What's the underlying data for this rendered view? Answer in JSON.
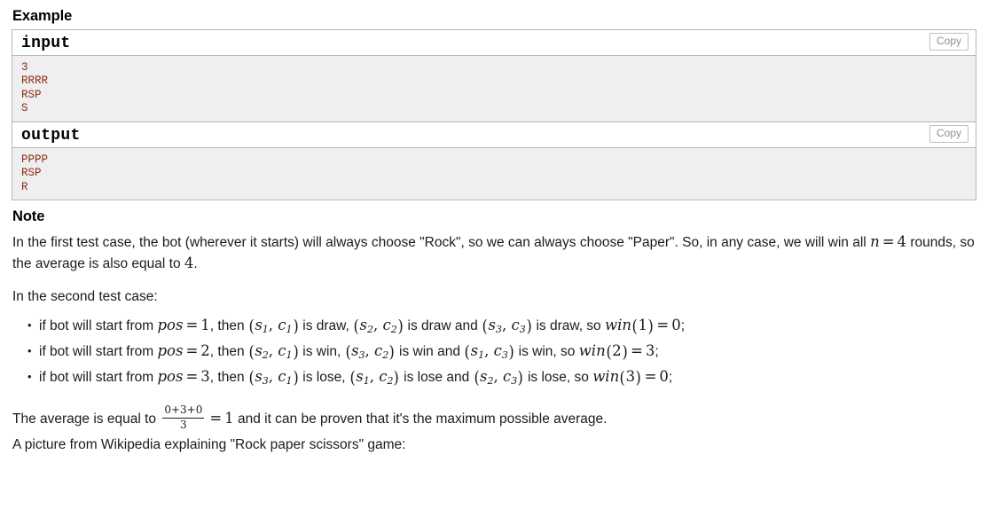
{
  "example": {
    "heading": "Example",
    "blocks": [
      {
        "title": "input",
        "copy_label": "Copy",
        "content": "3\nRRRR\nRSP\nS"
      },
      {
        "title": "output",
        "copy_label": "Copy",
        "content": "PPPP\nRSP\nR"
      }
    ]
  },
  "note": {
    "heading": "Note",
    "para1_a": "In the first test case, the bot (wherever it starts) will always choose \"Rock\", so we can always choose \"Paper\". So, in any case, we will win all ",
    "para1_math_n": "n",
    "para1_math_eq": "=",
    "para1_math_4": "4",
    "para1_b": " rounds, so the average is also equal to ",
    "para1_math_4b": "4",
    "para1_c": ".",
    "para2": "In the second test case:",
    "bullets": [
      {
        "lead": "if bot will start from ",
        "pos_var": "pos",
        "eq": "=",
        "pos_val": "1",
        "comma_then": ", then ",
        "pair1": [
          "s",
          "1",
          "c",
          "1"
        ],
        "res1": " is draw, ",
        "pair2": [
          "s",
          "2",
          "c",
          "2"
        ],
        "res2": " is draw and ",
        "pair3": [
          "s",
          "3",
          "c",
          "3"
        ],
        "res3": " is draw, so ",
        "win_fn": "win",
        "win_arg": "1",
        "win_eq": "=",
        "win_val": "0",
        "tail": ";"
      },
      {
        "lead": "if bot will start from ",
        "pos_var": "pos",
        "eq": "=",
        "pos_val": "2",
        "comma_then": ", then ",
        "pair1": [
          "s",
          "2",
          "c",
          "1"
        ],
        "res1": " is win, ",
        "pair2": [
          "s",
          "3",
          "c",
          "2"
        ],
        "res2": " is win and ",
        "pair3": [
          "s",
          "1",
          "c",
          "3"
        ],
        "res3": " is win, so ",
        "win_fn": "win",
        "win_arg": "2",
        "win_eq": "=",
        "win_val": "3",
        "tail": ";"
      },
      {
        "lead": "if bot will start from ",
        "pos_var": "pos",
        "eq": "=",
        "pos_val": "3",
        "comma_then": ", then ",
        "pair1": [
          "s",
          "3",
          "c",
          "1"
        ],
        "res1": " is lose, ",
        "pair2": [
          "s",
          "1",
          "c",
          "2"
        ],
        "res2": " is lose and ",
        "pair3": [
          "s",
          "2",
          "c",
          "3"
        ],
        "res3": " is lose, so ",
        "win_fn": "win",
        "win_arg": "3",
        "win_eq": "=",
        "win_val": "0",
        "tail": ";"
      }
    ],
    "para3_a": "The average is equal to ",
    "frac_num": "0+3+0",
    "frac_den": "3",
    "para3_eq": "=",
    "para3_val": "1",
    "para3_b": " and it can be proven that it's the maximum possible average.",
    "para4": "A picture from Wikipedia explaining \"Rock paper scissors\" game:"
  },
  "colors": {
    "sample_text": "#8b2a16",
    "sample_bg": "#efefef",
    "border": "#b7b7b7",
    "copy_text": "#8a8f96",
    "body_text": "#1b1b1b"
  }
}
